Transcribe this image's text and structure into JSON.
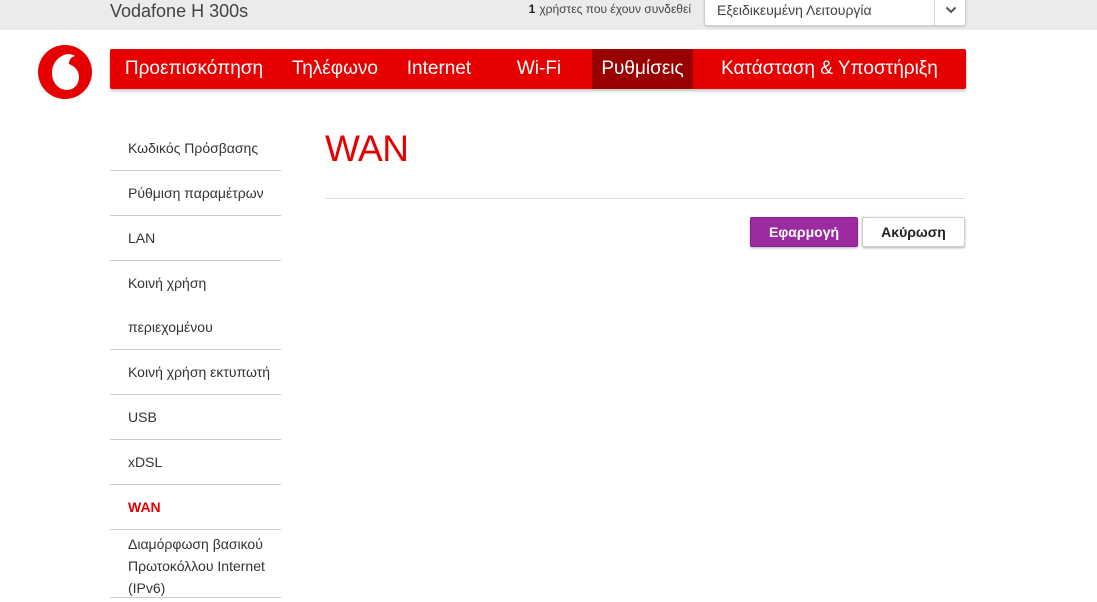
{
  "header": {
    "model": "Vodafone H 300s",
    "users_count": "1",
    "users_text": "χρήστες που έχουν συνδεθεί",
    "mode_select": {
      "value": "Εξειδικευμένη Λειτουργία",
      "icon": "chevron-down-icon"
    }
  },
  "brand": {
    "logo_icon": "vodafone-logo-icon",
    "color": "#e60000"
  },
  "nav": {
    "items": [
      {
        "label": "Προεπισκόπηση"
      },
      {
        "label": "Τηλέφωνο"
      },
      {
        "label": "Internet"
      },
      {
        "label": "Wi-Fi"
      },
      {
        "label": "Ρυθμίσεις",
        "active": true
      },
      {
        "label": "Κατάσταση & Υποστήριξη"
      }
    ],
    "active_color": "#990000"
  },
  "sidebar": {
    "items": [
      {
        "label": "Κωδικός Πρόσβασης"
      },
      {
        "label": "Ρύθμιση παραμέτρων"
      },
      {
        "label": "LAN"
      },
      {
        "label_lines": [
          "Κοινή χρήση",
          "περιεχομένου"
        ]
      },
      {
        "label": "Κοινή χρήση εκτυπωτή"
      },
      {
        "label": "USB"
      },
      {
        "label": "xDSL"
      },
      {
        "label": "WAN",
        "active": true
      },
      {
        "label_lines": [
          "Διαμόρφωση βασικού",
          "Πρωτοκόλλου Internet",
          "(IPv6)"
        ]
      }
    ]
  },
  "main": {
    "title": "WAN",
    "apply_label": "Εφαρμογή",
    "cancel_label": "Ακύρωση",
    "apply_color": "#9c2aa0"
  }
}
